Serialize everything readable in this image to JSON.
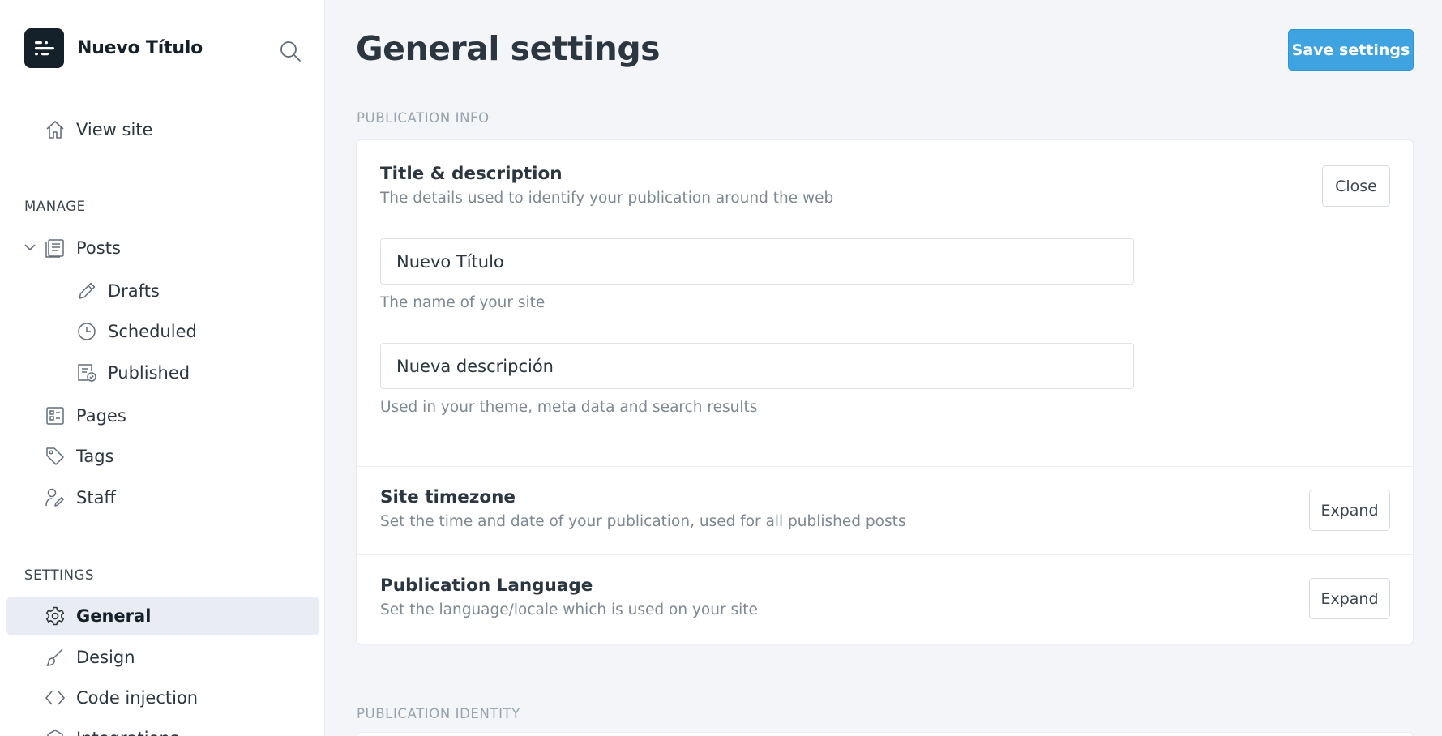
{
  "sidebar": {
    "brand_title": "Nuevo Título",
    "view_site": "View site",
    "manage_heading": "MANAGE",
    "posts": "Posts",
    "drafts": "Drafts",
    "scheduled": "Scheduled",
    "published": "Published",
    "pages": "Pages",
    "tags": "Tags",
    "staff": "Staff",
    "settings_heading": "SETTINGS",
    "general": "General",
    "design": "Design",
    "code_injection": "Code injection",
    "integrations": "Integrations"
  },
  "header": {
    "title": "General settings",
    "save_label": "Save settings"
  },
  "sections": {
    "publication_info": "PUBLICATION INFO",
    "publication_identity": "PUBLICATION IDENTITY"
  },
  "title_description": {
    "title": "Title & description",
    "description": "The details used to identify your publication around the web",
    "close_label": "Close",
    "site_title_value": "Nuevo Título",
    "site_title_hint": "The name of your site",
    "site_description_value": "Nueva descripción",
    "site_description_hint": "Used in your theme, meta data and search results"
  },
  "timezone": {
    "title": "Site timezone",
    "description": "Set the time and date of your publication, used for all published posts",
    "expand_label": "Expand"
  },
  "language": {
    "title": "Publication Language",
    "description": "Set the language/locale which is used on your site",
    "expand_label": "Expand"
  },
  "colors": {
    "accent": "#3ea3e0",
    "brand_bg": "#15212a",
    "active_nav_bg": "#e9ecf2"
  }
}
